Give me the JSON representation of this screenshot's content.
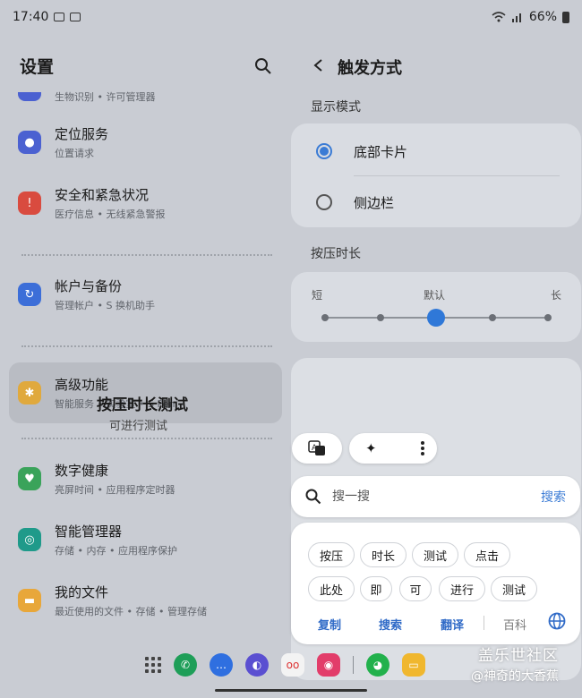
{
  "status": {
    "time": "17:40",
    "battery": "66%"
  },
  "left": {
    "title": "设置",
    "partial_subtitle": "生物识别 • 许可管理器",
    "items": [
      {
        "title": "定位服务",
        "subtitle": "位置请求",
        "color": "#4b61d1"
      },
      {
        "title": "安全和紧急状况",
        "subtitle": "医疗信息 • 无线紧急警报",
        "color": "#d94b3f"
      },
      {
        "title": "帐户与备份",
        "subtitle": "管理帐户 • S 换机助手",
        "color": "#3c6ed8"
      },
      {
        "title": "高级功能",
        "subtitle": "智能服务 • 实验室 • S Pen",
        "color": "#e0a93d"
      },
      {
        "title": "数字健康",
        "subtitle": "亮屏时间 • 应用程序定时器",
        "color": "#3aa35a"
      },
      {
        "title": "智能管理器",
        "subtitle": "存储 • 内存 • 应用程序保护",
        "color": "#1f9a8a"
      },
      {
        "title": "我的文件",
        "subtitle": "最近使用的文件 • 存储 • 管理存储",
        "color": "#e8a73a"
      }
    ]
  },
  "right": {
    "title": "触发方式",
    "display_mode_label": "显示模式",
    "options": [
      {
        "label": "底部卡片",
        "selected": true
      },
      {
        "label": "侧边栏",
        "selected": false
      }
    ],
    "press_label": "按压时长",
    "slider": {
      "short": "短",
      "default": "默认",
      "long": "长",
      "steps": 5,
      "value_index": 2
    },
    "test_title": "按压时长测试",
    "test_sub": "可进行测试"
  },
  "popup": {
    "search_placeholder": "搜一搜",
    "search_button": "搜索",
    "tokens_row1": [
      "按压",
      "时长",
      "测试",
      "点击"
    ],
    "tokens_row2": [
      "此处",
      "即",
      "可",
      "进行",
      "测试"
    ],
    "actions": [
      "复制",
      "搜索",
      "翻译"
    ],
    "action_extra": "百科"
  },
  "watermark": {
    "line1": "盖乐世社区",
    "line2": "@神奇的大香蕉"
  },
  "colors": {
    "accent": "#3a7bd5"
  }
}
